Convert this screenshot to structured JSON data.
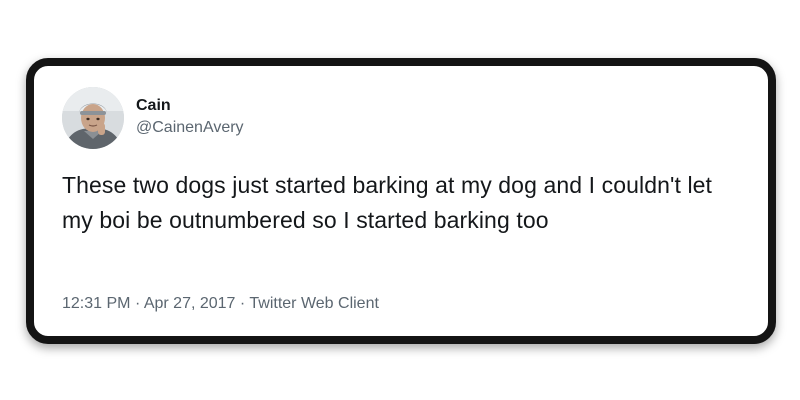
{
  "tweet": {
    "author": {
      "display_name": "Cain",
      "handle": "@CainenAvery",
      "avatar_icon": "user-avatar-photo"
    },
    "text": "These two dogs just started barking at my dog and I couldn't let my boi be outnumbered so I started barking too",
    "meta": {
      "time": "12:31 PM",
      "date": "Apr 27, 2017",
      "source": "Twitter Web Client",
      "separator": "·"
    }
  },
  "colors": {
    "card_border": "#141414",
    "text_primary": "#14171a",
    "text_secondary": "#5b6670",
    "background": "#ffffff"
  }
}
